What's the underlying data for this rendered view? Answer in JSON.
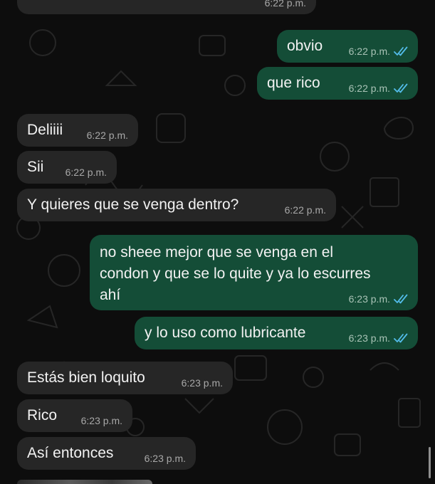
{
  "chat": {
    "messages": [
      {
        "id": "m0",
        "direction": "in",
        "text": "",
        "time": "6:22 p.m."
      },
      {
        "id": "m1",
        "direction": "out",
        "text": "obvio",
        "time": "6:22 p.m.",
        "status": "read"
      },
      {
        "id": "m2",
        "direction": "out",
        "text": "que rico",
        "time": "6:22 p.m.",
        "status": "read"
      },
      {
        "id": "m3",
        "direction": "in",
        "text": "Deliiii",
        "time": "6:22 p.m."
      },
      {
        "id": "m4",
        "direction": "in",
        "text": "Sii",
        "time": "6:22 p.m."
      },
      {
        "id": "m5",
        "direction": "in",
        "text": "Y quieres que se venga dentro?",
        "time": "6:22 p.m."
      },
      {
        "id": "m6",
        "direction": "out",
        "lines": [
          "no sheee mejor que se venga en el",
          "condon y que se lo quite y ya lo escurres",
          "ahí"
        ],
        "time": "6:23 p.m.",
        "status": "read"
      },
      {
        "id": "m7",
        "direction": "out",
        "text": "y lo uso como lubricante",
        "time": "6:23 p.m.",
        "status": "read"
      },
      {
        "id": "m8",
        "direction": "in",
        "text": "Estás bien loquito",
        "time": "6:23 p.m."
      },
      {
        "id": "m9",
        "direction": "in",
        "text": "Rico",
        "time": "6:23 p.m."
      },
      {
        "id": "m10",
        "direction": "in",
        "text": "Así entonces",
        "time": "6:23 p.m."
      }
    ]
  },
  "colors": {
    "background": "#0d0d0d",
    "incoming_bubble": "#262626",
    "outgoing_bubble": "#144d37",
    "read_tick": "#53bdeb"
  },
  "icons": {
    "read_receipt": "double-check-icon"
  }
}
